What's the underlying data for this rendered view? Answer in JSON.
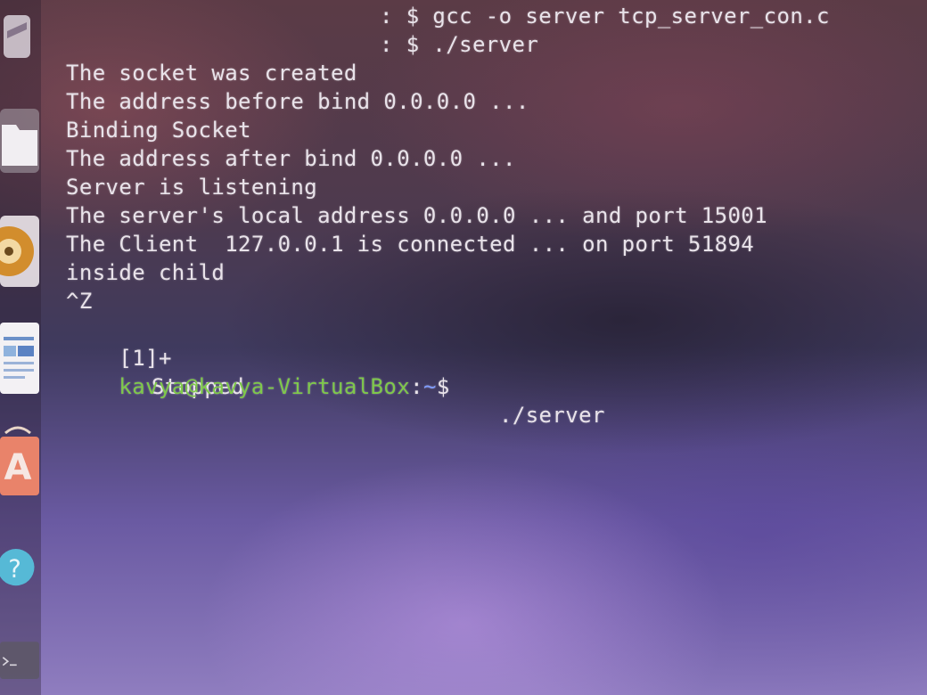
{
  "terminal": {
    "cmd_compile": ": $ gcc -o server tcp_server_con.c",
    "cmd_run": ": $ ./server",
    "lines": [
      "The socket was created",
      "The address before bind 0.0.0.0 ...",
      "Binding Socket",
      "The address after bind 0.0.0.0 ...",
      "Server is listening",
      "The server's local address 0.0.0.0 ... and port 15001",
      "The Client  127.0.0.1 is connected ... on port 51894",
      "inside child",
      "^Z"
    ],
    "job_id": "[1]+",
    "job_status": "Stopped",
    "job_command": "./server",
    "prompt": {
      "user_host": "kavya@kavya-VirtualBox",
      "separator": ":",
      "path": "~",
      "symbol": "$"
    }
  },
  "launcher": {
    "icons": [
      "window-icon",
      "files-icon",
      "music-icon",
      "writer-icon",
      "software-store-icon",
      "help-icon",
      "terminal-icon"
    ],
    "help_glyph": "?",
    "store_glyph": "A"
  },
  "colors": {
    "terminal_text": "#e9e3ea",
    "prompt_user": "#7fc94a",
    "prompt_path": "#7f9cff"
  }
}
